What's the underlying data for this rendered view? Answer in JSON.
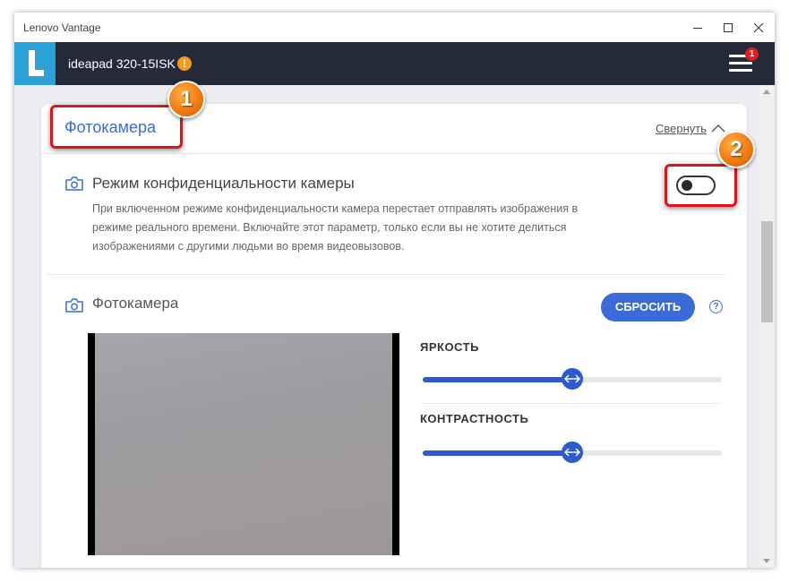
{
  "window": {
    "title": "Lenovo Vantage"
  },
  "appbar": {
    "device_name": "ideapad 320-15ISK",
    "warning_glyph": "!",
    "notification_count": "1"
  },
  "section": {
    "title": "Фотокамера",
    "collapse_label": "Свернуть"
  },
  "privacy": {
    "label": "Режим конфиденциальности камеры",
    "description": "При включенном режиме конфиденциальности камера перестает отправлять изображения в режиме реального времени. Включайте этот параметр, только если вы не хотите делиться изображениями с другими людьми во время видеовызовов.",
    "enabled": false
  },
  "camera": {
    "label": "Фотокамера",
    "reset_label": "СБРОСИТЬ",
    "help_glyph": "?"
  },
  "settings": {
    "brightness_label": "ЯРКОСТЬ",
    "brightness_level": 0.5,
    "contrast_label": "КОНТРАСТНОСТЬ",
    "contrast_level": 0.5
  },
  "annotations": {
    "marker_1": "1",
    "marker_2": "2"
  },
  "colors": {
    "accent": "#3a6bd8",
    "appbar": "#242a38",
    "logo": "#2aa2d8",
    "callout": "#e0121b",
    "marker": "#f27a10"
  },
  "icons": {
    "logo": "lenovo-l-logo",
    "warning": "warning-icon",
    "menu": "hamburger-menu-icon",
    "collapse": "chevron-up-icon",
    "camera": "camera-icon",
    "slider_thumb": "double-arrow-icon"
  }
}
